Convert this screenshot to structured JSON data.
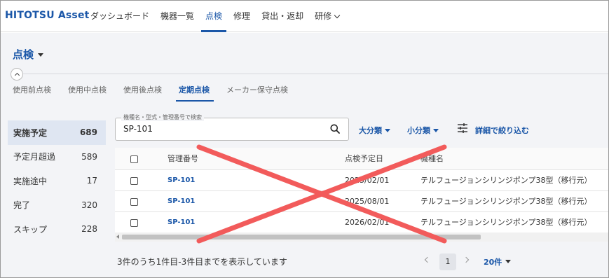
{
  "app": {
    "logo": "HITOTSU Asset",
    "nav": [
      {
        "label": "ダッシュボード",
        "active": false
      },
      {
        "label": "機器一覧",
        "active": false
      },
      {
        "label": "点検",
        "active": true
      },
      {
        "label": "修理",
        "active": false
      },
      {
        "label": "貸出・返却",
        "active": false
      },
      {
        "label": "研修",
        "active": false,
        "dropdown": true
      }
    ]
  },
  "page": {
    "title": "点検",
    "tabs": [
      {
        "label": "使用前点検",
        "active": false
      },
      {
        "label": "使用中点検",
        "active": false
      },
      {
        "label": "使用後点検",
        "active": false
      },
      {
        "label": "定期点検",
        "active": true
      },
      {
        "label": "メーカー保守点検",
        "active": false
      }
    ]
  },
  "status_filters": [
    {
      "label": "実施予定",
      "count": "689",
      "active": true
    },
    {
      "label": "予定月超過",
      "count": "589",
      "active": false
    },
    {
      "label": "実施途中",
      "count": "17",
      "active": false
    },
    {
      "label": "完了",
      "count": "320",
      "active": false
    },
    {
      "label": "スキップ",
      "count": "228",
      "active": false
    }
  ],
  "search": {
    "label": "機種名・型式・管理番号で検索",
    "value": "SP-101"
  },
  "filters": {
    "major_category": "大分類",
    "minor_category": "小分類",
    "advanced": "詳細で絞り込む"
  },
  "table": {
    "headers": {
      "id": "管理番号",
      "date": "点検予定日",
      "model": "機種名"
    },
    "rows": [
      {
        "id": "SP-101",
        "date": "2025/02/01",
        "model": "テルフュージョンシリンジポンプ38型（移行元）"
      },
      {
        "id": "SP-101",
        "date": "2025/08/01",
        "model": "テルフュージョンシリンジポンプ38型（移行元）"
      },
      {
        "id": "SP-101",
        "date": "2026/02/01",
        "model": "テルフュージョンシリンジポンプ38型（移行元）"
      }
    ]
  },
  "footer": {
    "summary": "3件のうち1件目-3件目までを表示しています",
    "current_page": "1",
    "per_page": "20件"
  },
  "overlay": {
    "mark": "red-x",
    "color": "#f25b5b"
  }
}
